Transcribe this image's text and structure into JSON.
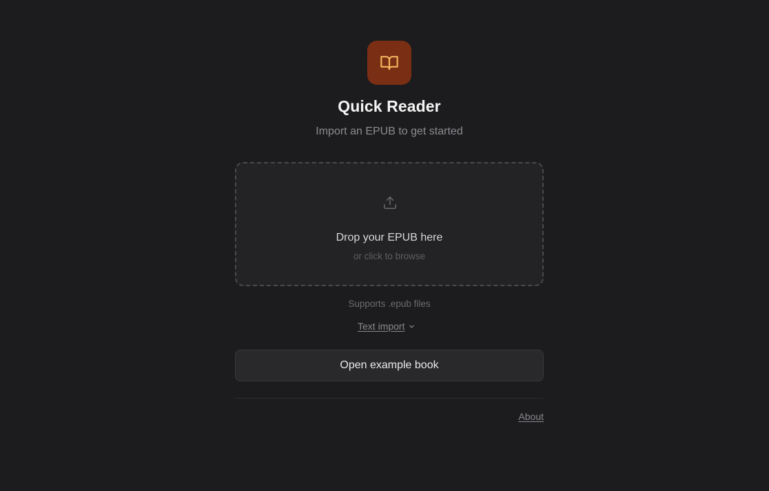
{
  "app": {
    "title": "Quick Reader",
    "subtitle": "Import an EPUB to get started",
    "icon": "book-open-icon",
    "accent_color": "#7a2e14"
  },
  "dropzone": {
    "icon": "upload-icon",
    "title": "Drop your EPUB here",
    "subtitle": "or click to browse"
  },
  "supports_text": "Supports .epub files",
  "text_import": {
    "label": "Text import",
    "icon": "chevron-down-icon"
  },
  "example_button_label": "Open example book",
  "footer": {
    "about_label": "About"
  }
}
